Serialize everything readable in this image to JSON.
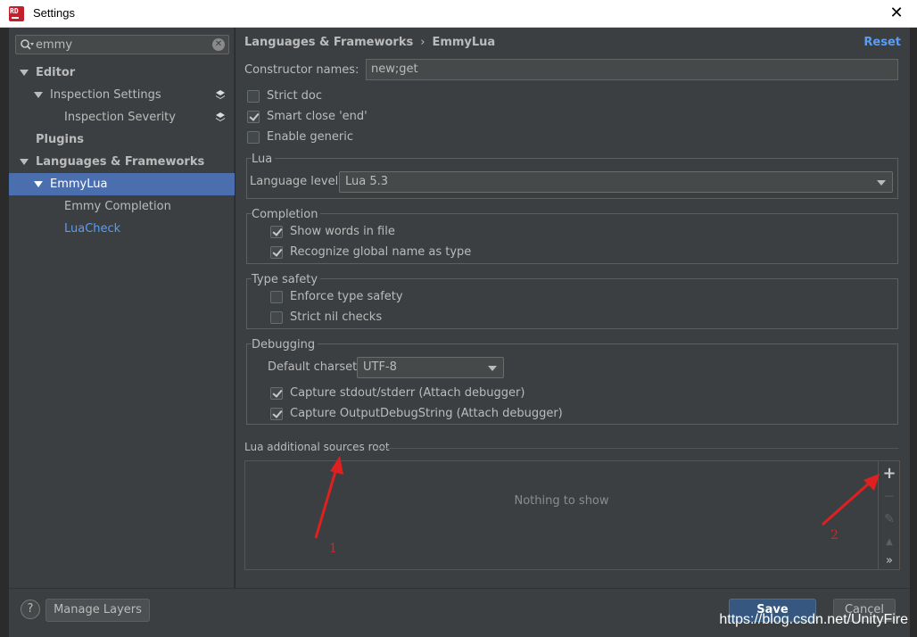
{
  "window": {
    "title": "Settings",
    "app_icon_text": "RD",
    "close_glyph": "✕"
  },
  "sidebar": {
    "search_value": "emmy",
    "search_placeholder": "",
    "search_clear_glyph": "✕",
    "items": [
      {
        "label": "Editor",
        "level": 0,
        "expanded": true,
        "bold": true
      },
      {
        "label": "Inspection Settings",
        "level": 1,
        "expanded": true,
        "bold": false
      },
      {
        "label": "Inspection Severity",
        "level": 2,
        "bold": false
      },
      {
        "label": "Plugins",
        "level": 0,
        "bold": true
      },
      {
        "label": "Languages & Frameworks",
        "level": 0,
        "expanded": true,
        "bold": true
      },
      {
        "label": "EmmyLua",
        "level": 1,
        "expanded": true,
        "selected": true
      },
      {
        "label": "Emmy Completion",
        "level": 2
      },
      {
        "label": "LuaCheck",
        "level": 2,
        "link": true
      }
    ]
  },
  "header": {
    "breadcrumb_parent": "Languages & Frameworks",
    "breadcrumb_separator": "›",
    "breadcrumb_current": "EmmyLua",
    "reset_label": "Reset"
  },
  "form": {
    "constructor_label": "Constructor names:",
    "constructor_value": "new;get",
    "strict_doc": {
      "label": "Strict doc",
      "checked": false
    },
    "smart_close": {
      "label": "Smart close 'end'",
      "checked": true
    },
    "enable_generic": {
      "label": "Enable generic",
      "checked": false
    },
    "lua_group": {
      "title": "Lua",
      "language_level_label": "Language level",
      "language_level_value": "Lua 5.3"
    },
    "completion_group": {
      "title": "Completion",
      "show_words": {
        "label": "Show words in file",
        "checked": true
      },
      "recognize_global": {
        "label": "Recognize global name as type",
        "checked": true
      }
    },
    "type_safety_group": {
      "title": "Type safety",
      "enforce": {
        "label": "Enforce type safety",
        "checked": false
      },
      "strict_nil": {
        "label": "Strict nil checks",
        "checked": false
      }
    },
    "debugging_group": {
      "title": "Debugging",
      "charset_label": "Default charset",
      "charset_value": "UTF-8",
      "capture_stdout": {
        "label": "Capture stdout/stderr (Attach debugger)",
        "checked": true
      },
      "capture_debug": {
        "label": "Capture OutputDebugString (Attach debugger)",
        "checked": true
      }
    },
    "sources": {
      "title": "Lua additional sources root",
      "empty_text": "Nothing to show",
      "toolbar": {
        "add": "+",
        "remove": "—",
        "edit": "✎",
        "up": "▲",
        "more": "»"
      }
    }
  },
  "footer": {
    "help_label": "?",
    "manage_layers_label": "Manage Layers",
    "save_label": "Save",
    "cancel_label": "Cancel"
  },
  "annotations": {
    "marker_1": "1",
    "marker_2": "2",
    "color": "#e02020"
  },
  "watermark": "https://blog.csdn.net/UnityFire",
  "colors": {
    "accent": "#4b6eaf",
    "link": "#589df6",
    "panel": "#3c3f41",
    "primary_button": "#365880"
  }
}
